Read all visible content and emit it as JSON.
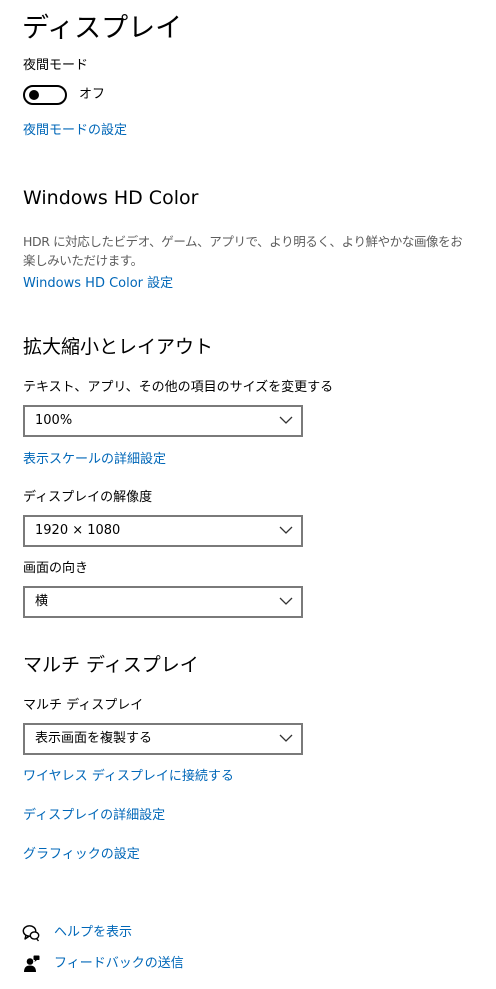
{
  "page_title": "ディスプレイ",
  "night_light": {
    "label": "夜間モード",
    "toggle_state": "オフ",
    "settings_link": "夜間モードの設定"
  },
  "hdr": {
    "title": "Windows HD Color",
    "description": "HDR に対応したビデオ、ゲーム、アプリで、より明るく、より鮮やかな画像をお楽しみいただけます。",
    "settings_link": "Windows HD Color 設定"
  },
  "scale_layout": {
    "title": "拡大縮小とレイアウト",
    "size_label": "テキスト、アプリ、その他の項目のサイズを変更する",
    "size_value": "100%",
    "advanced_scaling_link": "表示スケールの詳細設定",
    "resolution_label": "ディスプレイの解像度",
    "resolution_value": "1920 × 1080",
    "orientation_label": "画面の向き",
    "orientation_value": "横"
  },
  "multi_display": {
    "title": "マルチ ディスプレイ",
    "label": "マルチ ディスプレイ",
    "value": "表示画面を複製する",
    "wireless_link": "ワイヤレス ディスプレイに接続する",
    "advanced_link": "ディスプレイの詳細設定",
    "graphics_link": "グラフィックの設定"
  },
  "footer": {
    "help": {
      "label": "ヘルプを表示",
      "icon": "help-chat-icon"
    },
    "feedback": {
      "label": "フィードバックの送信",
      "icon": "feedback-person-icon"
    }
  },
  "colors": {
    "link": "#0067b8",
    "text": "#000000",
    "secondary_text": "#5d5d5d",
    "dropdown_border": "#7a7a7a"
  }
}
